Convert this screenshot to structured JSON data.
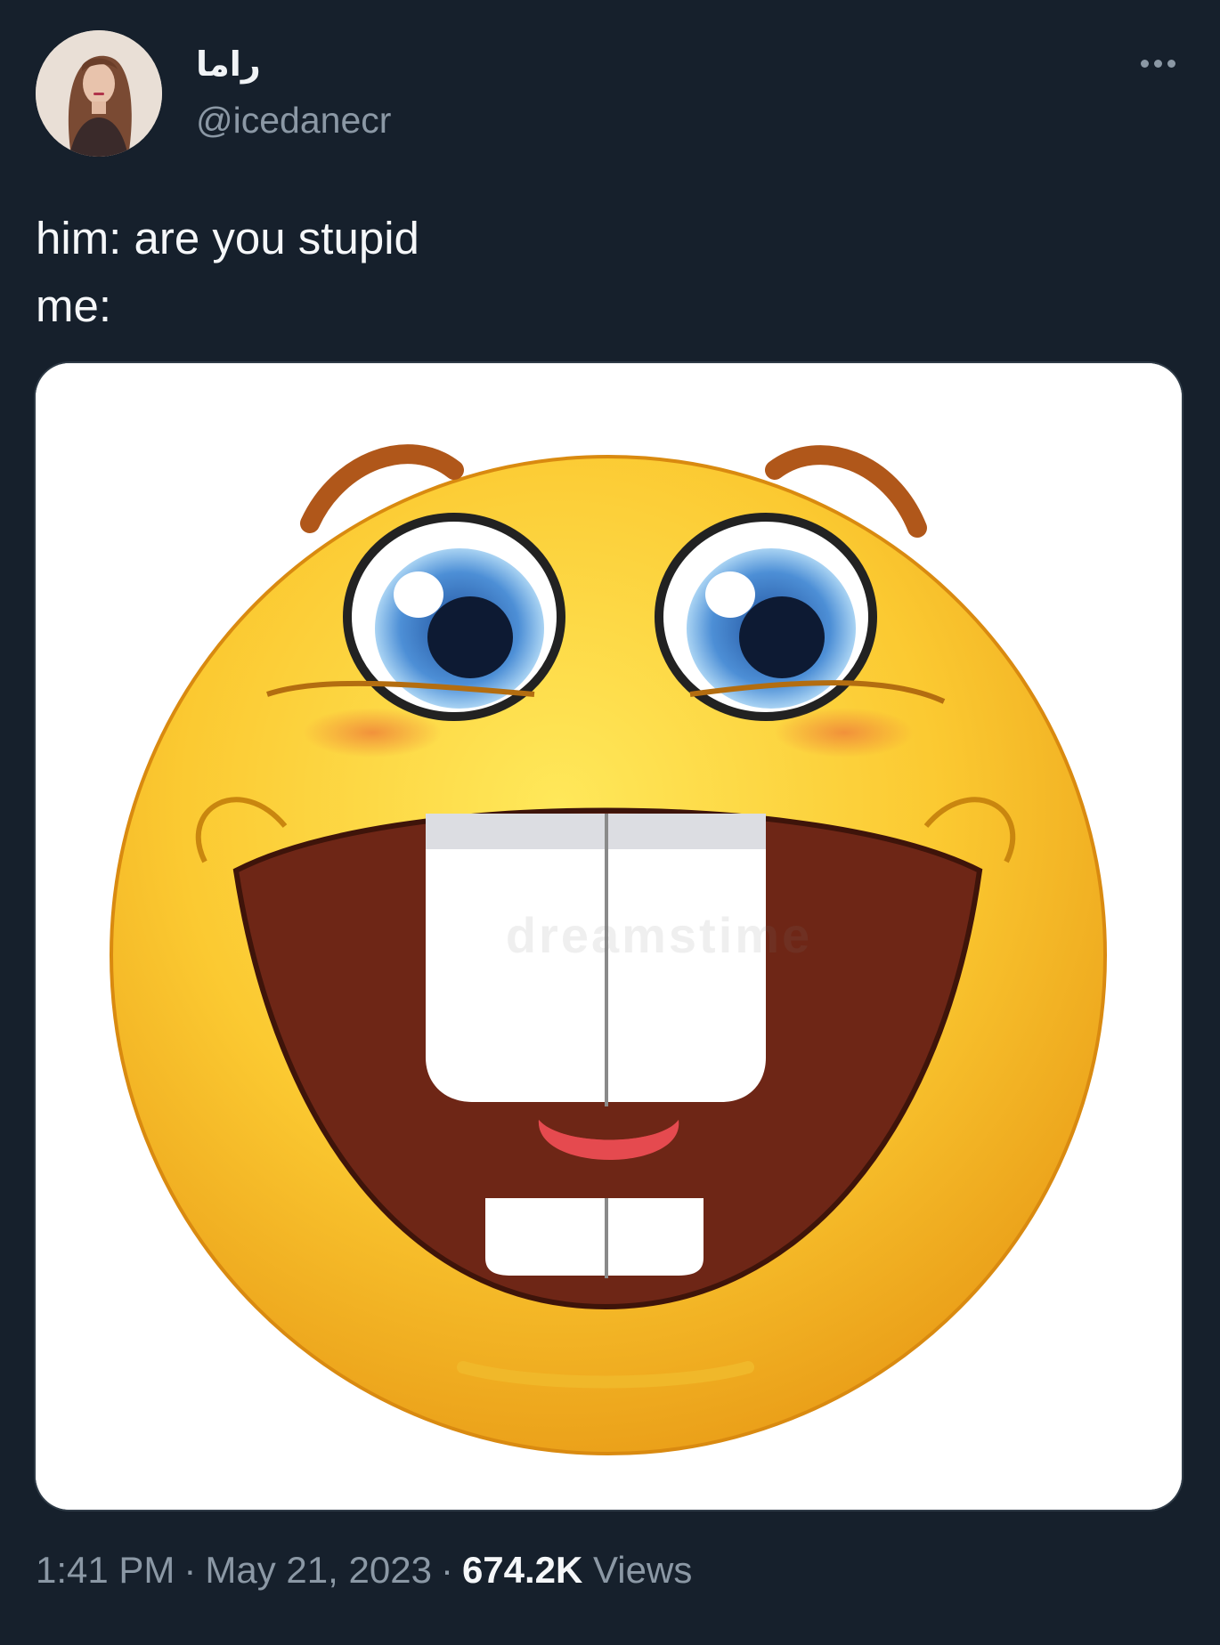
{
  "author": {
    "display_name": "راما",
    "handle": "@icedanecr"
  },
  "tweet": {
    "text": "him: are you stupid\nme:"
  },
  "media": {
    "watermark": "dreamstime"
  },
  "meta": {
    "time": "1:41 PM",
    "separator": "·",
    "date": "May 21, 2023",
    "views_count": "674.2K",
    "views_label": "Views"
  },
  "colors": {
    "background": "#16202c",
    "muted_text": "#8b98a5",
    "primary_text": "#f5f7f9"
  },
  "icons": {
    "more": "more-horizontal-icon"
  }
}
